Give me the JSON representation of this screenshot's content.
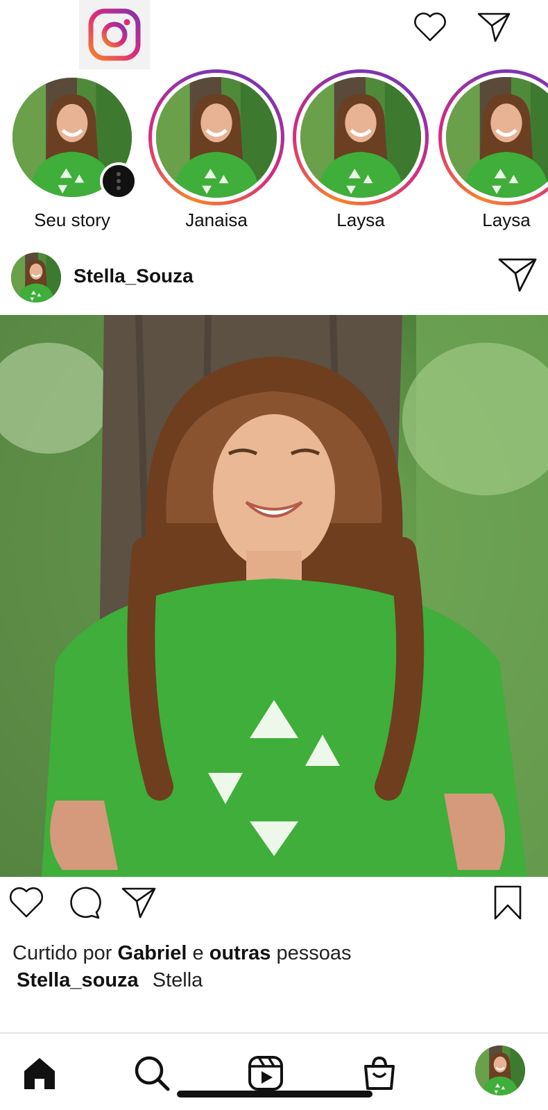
{
  "app": {
    "name": "Instagram"
  },
  "header": {
    "logo_icon": "instagram-logo",
    "activity_icon": "heart-icon",
    "direct_icon": "paper-plane-icon"
  },
  "stories": [
    {
      "name": "Seu story",
      "own": true
    },
    {
      "name": "Janaisa",
      "own": false
    },
    {
      "name": "Laysa",
      "own": false
    },
    {
      "name": "Laysa",
      "own": false
    }
  ],
  "post": {
    "username": "Stella_Souza",
    "liked_prefix": "Curtido por",
    "liked_user": "Gabriel",
    "liked_conj": "e",
    "liked_others": "outras",
    "liked_suffix": "pessoas",
    "caption_user": "Stella_souza",
    "caption_text": "Stella"
  },
  "actions": {
    "like_icon": "heart-icon",
    "comment_icon": "comment-icon",
    "share_icon": "paper-plane-icon",
    "save_icon": "bookmark-icon"
  },
  "bottom_nav": [
    {
      "icon": "home-icon",
      "active": true
    },
    {
      "icon": "search-icon",
      "active": false
    },
    {
      "icon": "reels-icon",
      "active": false
    },
    {
      "icon": "shop-icon",
      "active": false
    },
    {
      "icon": "profile-avatar",
      "active": false
    }
  ],
  "colors": {
    "brand_gradient": [
      "#f58529",
      "#dd2a7b",
      "#8134af"
    ],
    "text": "#111111",
    "shirt_green": "#3fae3a"
  }
}
